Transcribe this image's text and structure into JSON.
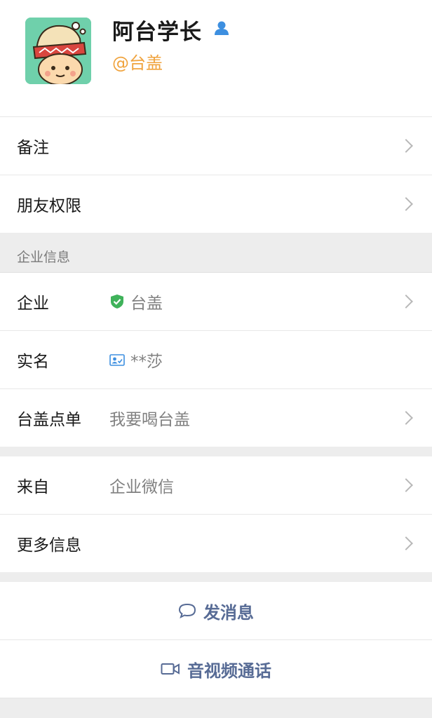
{
  "profile": {
    "name": "阿台学长",
    "handle": "@台盖"
  },
  "top_rows": [
    {
      "label": "备注"
    },
    {
      "label": "朋友权限"
    }
  ],
  "enterprise": {
    "section_title": "企业信息",
    "rows": [
      {
        "label": "企业",
        "value": "台盖",
        "icon": "shield-check-icon"
      },
      {
        "label": "实名",
        "value": "**莎",
        "icon": "id-card-icon"
      },
      {
        "label": "台盖点单",
        "value": "我要喝台盖"
      }
    ]
  },
  "more_rows": [
    {
      "label": "来自",
      "value": "企业微信"
    },
    {
      "label": "更多信息"
    }
  ],
  "actions": {
    "message": "发消息",
    "call": "音视频通话"
  },
  "colors": {
    "accent_link": "#576b95",
    "handle_orange": "#f0a33d",
    "verified_green": "#3fb25a",
    "verify_blue": "#3d8fe0"
  }
}
